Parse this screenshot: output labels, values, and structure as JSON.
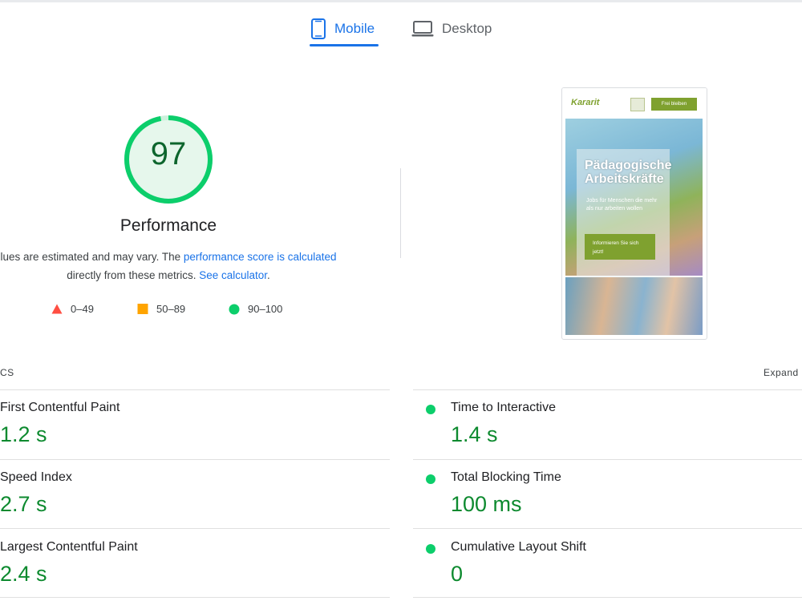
{
  "tabs": [
    {
      "label": "Mobile",
      "icon": "smartphone-icon",
      "active": true
    },
    {
      "label": "Desktop",
      "icon": "laptop-icon",
      "active": false
    }
  ],
  "gauge": {
    "score": "97",
    "fraction": 0.97,
    "title": "Performance",
    "color": "#0cce6b"
  },
  "description": {
    "text1": "lues are estimated and may vary. The ",
    "link1": "performance score is calculated",
    "text2": "directly from these metrics. ",
    "link2": "See calculator",
    "text3": "."
  },
  "legend": [
    {
      "range": "0–49",
      "shape": "triangle",
      "color": "#ff4e42"
    },
    {
      "range": "50–89",
      "shape": "square",
      "color": "#ffa400"
    },
    {
      "range": "90–100",
      "shape": "circle",
      "color": "#0cce6b"
    }
  ],
  "preview": {
    "logo": "Kararit",
    "cta": "Frei bleiben",
    "hero_title": "Pädagogische Arbeitskräfte",
    "hero_sub": "Jobs für Menschen die mehr als nur arbeiten wollen",
    "hero_button": "Informieren Sie sich jetzt!"
  },
  "metrics_header": {
    "left": "CS",
    "right": "Expand"
  },
  "metrics": [
    {
      "label": "First Contentful Paint",
      "value": "1.2 s"
    },
    {
      "label": "Time to Interactive",
      "value": "1.4 s"
    },
    {
      "label": "Speed Index",
      "value": "2.7 s"
    },
    {
      "label": "Total Blocking Time",
      "value": "100 ms"
    },
    {
      "label": "Largest Contentful Paint",
      "value": "2.4 s"
    },
    {
      "label": "Cumulative Layout Shift",
      "value": "0"
    }
  ]
}
